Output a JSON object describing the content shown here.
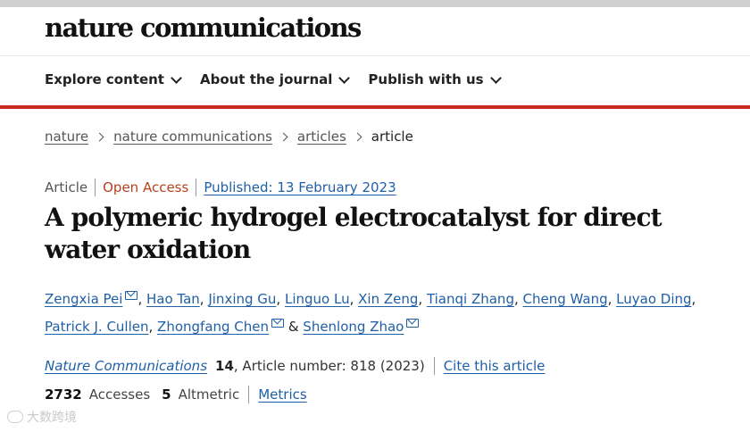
{
  "site": {
    "brand": "nature communications"
  },
  "nav": [
    {
      "label": "Explore content"
    },
    {
      "label": "About the journal"
    },
    {
      "label": "Publish with us"
    }
  ],
  "breadcrumb": {
    "items": [
      "nature",
      "nature communications",
      "articles"
    ],
    "current": "article"
  },
  "meta": {
    "type": "Article",
    "access": "Open Access",
    "published": "Published: 13 February 2023"
  },
  "article": {
    "title": "A polymeric hydrogel electrocatalyst for direct water oxidation",
    "and": "&",
    "authors": [
      {
        "name": "Zengxia Pei",
        "email": true
      },
      {
        "name": "Hao Tan",
        "email": false
      },
      {
        "name": "Jinxing Gu",
        "email": false
      },
      {
        "name": "Linguo Lu",
        "email": false
      },
      {
        "name": "Xin Zeng",
        "email": false
      },
      {
        "name": "Tianqi Zhang",
        "email": false
      },
      {
        "name": "Cheng Wang",
        "email": false
      },
      {
        "name": "Luyao Ding",
        "email": false
      },
      {
        "name": "Patrick J. Cullen",
        "email": false
      },
      {
        "name": "Zhongfang Chen",
        "email": true
      },
      {
        "name": "Shenlong Zhao",
        "email": true
      }
    ]
  },
  "journal": {
    "name": "Nature Communications",
    "volume": "14",
    "article_number": ", Article number: 818 (2023)",
    "cite": "Cite this article"
  },
  "metrics": {
    "accesses_value": "2732",
    "accesses_label": "Accesses",
    "altmetric_value": "5",
    "altmetric_label": "Altmetric",
    "link": "Metrics"
  },
  "watermark": {
    "text": "大数跨境"
  },
  "colors": {
    "accent_red": "#c8281e",
    "link_blue": "#1f5fa6",
    "open_access": "#b5411e"
  }
}
